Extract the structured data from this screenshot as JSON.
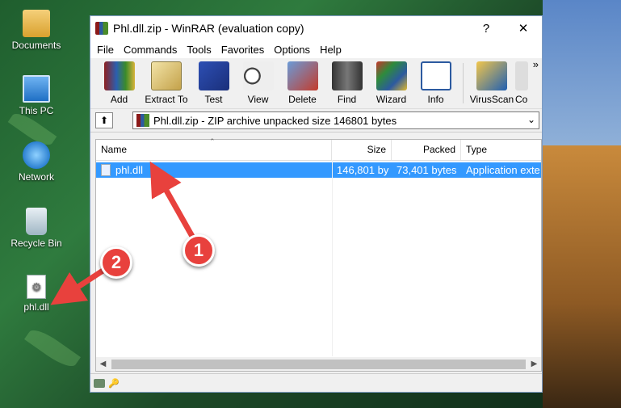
{
  "desktop": {
    "icons": [
      {
        "label": "Documents",
        "icon": "documents-folder-icon"
      },
      {
        "label": "This PC",
        "icon": "computer-icon"
      },
      {
        "label": "Network",
        "icon": "network-icon"
      },
      {
        "label": "Recycle Bin",
        "icon": "recycle-bin-icon"
      },
      {
        "label": "phl.dll",
        "icon": "dll-file-icon"
      }
    ]
  },
  "window": {
    "title": "Phl.dll.zip - WinRAR (evaluation copy)",
    "help_label": "?",
    "close_label": "✕"
  },
  "menu": [
    "File",
    "Commands",
    "Tools",
    "Favorites",
    "Options",
    "Help"
  ],
  "toolbar": {
    "tools": [
      {
        "label": "Add",
        "icon": "add-archive-icon"
      },
      {
        "label": "Extract To",
        "icon": "extract-folder-icon"
      },
      {
        "label": "Test",
        "icon": "test-icon"
      },
      {
        "label": "View",
        "icon": "view-glasses-icon"
      },
      {
        "label": "Delete",
        "icon": "delete-icon"
      },
      {
        "label": "Find",
        "icon": "binoculars-icon"
      },
      {
        "label": "Wizard",
        "icon": "wizard-icon"
      },
      {
        "label": "Info",
        "icon": "info-icon"
      },
      {
        "label": "VirusScan",
        "icon": "virus-scan-icon"
      },
      {
        "label": "Co",
        "icon": "comment-icon"
      }
    ],
    "more_label": "»"
  },
  "path": {
    "text": "Phl.dll.zip - ZIP archive unpacked size 146801 bytes",
    "up_label": "⬆"
  },
  "list": {
    "columns": [
      "Name",
      "Size",
      "Packed",
      "Type"
    ],
    "rows": [
      {
        "name": "phl.dll",
        "size": "146,801 by",
        "packed": "73,401 bytes",
        "type": "Application exte"
      }
    ]
  },
  "callouts": [
    "1",
    "2"
  ],
  "colors": {
    "selection": "#3399ff",
    "callout": "#e8413d"
  }
}
